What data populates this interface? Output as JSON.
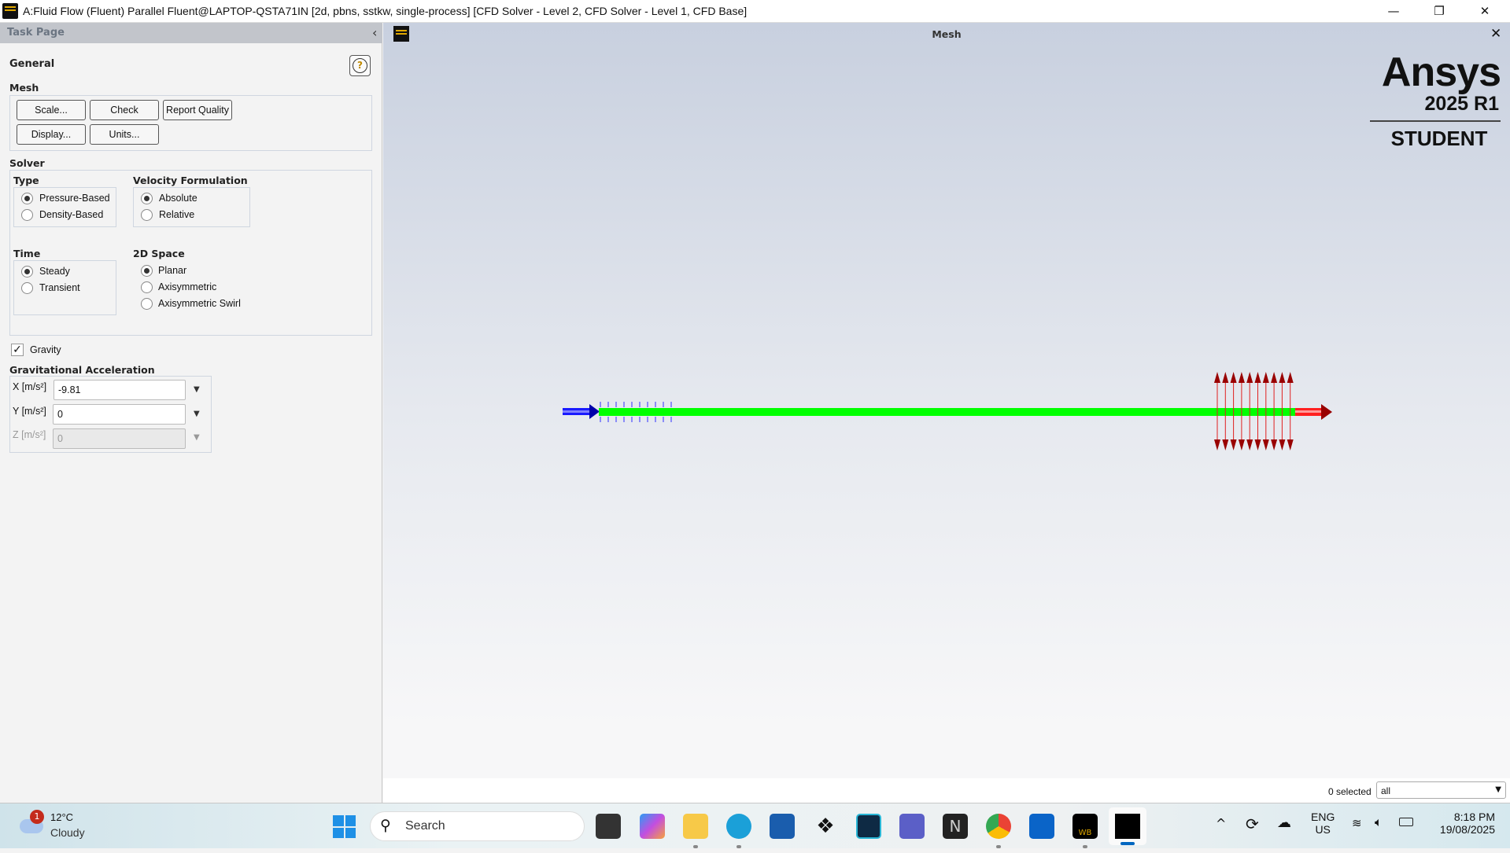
{
  "window": {
    "title": "A:Fluid Flow (Fluent) Parallel Fluent@LAPTOP-QSTA71IN  [2d, pbns, sstkw, single-process] [CFD Solver - Level 2, CFD Solver - Level 1, CFD Base]",
    "minimize": "—",
    "restore": "❐",
    "close": "✕"
  },
  "panel": {
    "header": "Task Page",
    "collapse": "‹",
    "title": "General",
    "help": "?",
    "mesh": {
      "label": "Mesh",
      "buttons": [
        "Scale...",
        "Check",
        "Report Quality",
        "Display...",
        "Units..."
      ]
    },
    "solver": {
      "label": "Solver",
      "type": {
        "label": "Type",
        "options": [
          "Pressure-Based",
          "Density-Based"
        ],
        "selected": "Pressure-Based"
      },
      "velocity": {
        "label": "Velocity Formulation",
        "options": [
          "Absolute",
          "Relative"
        ],
        "selected": "Absolute"
      },
      "time": {
        "label": "Time",
        "options": [
          "Steady",
          "Transient"
        ],
        "selected": "Steady"
      },
      "space": {
        "label": "2D Space",
        "options": [
          "Planar",
          "Axisymmetric",
          "Axisymmetric Swirl"
        ],
        "selected": "Planar"
      }
    },
    "gravity": {
      "label": "Gravity",
      "checked": true
    },
    "accel": {
      "label": "Gravitational Acceleration",
      "x": {
        "label": "X [m/s²]",
        "value": "-9.81"
      },
      "y": {
        "label": "Y [m/s²]",
        "value": "0"
      },
      "z": {
        "label": "Z [m/s²]",
        "value": "0"
      }
    }
  },
  "graphics": {
    "title": "Mesh",
    "close": "✕",
    "logo": {
      "brand": "Ansys",
      "version": "2025 R1",
      "edition": "STUDENT"
    },
    "selected": "0 selected",
    "filter": "all"
  },
  "taskbar": {
    "weather": {
      "temp": "12°C",
      "cond": "Cloudy",
      "badge": "1"
    },
    "search": "Search",
    "lang": "ENG",
    "region": "US",
    "time": "8:18 PM",
    "date": "19/08/2025"
  }
}
